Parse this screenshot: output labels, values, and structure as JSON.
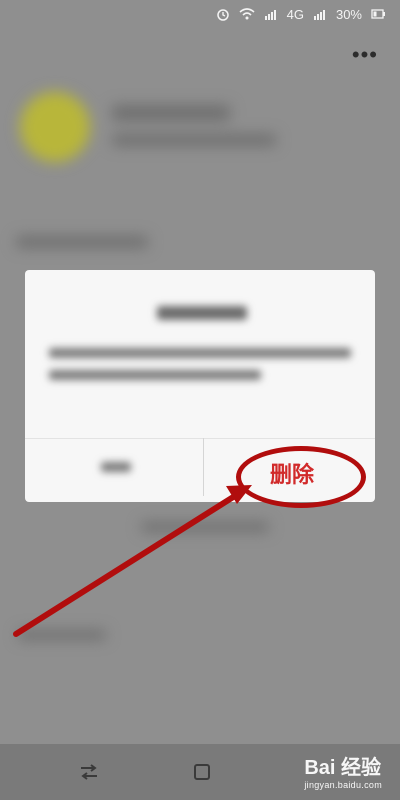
{
  "status_bar": {
    "signal_type": "4G",
    "battery_percent": "30%",
    "icons": [
      "alarm-icon",
      "wifi-icon",
      "signal-icon",
      "signal-icon",
      "battery-icon"
    ]
  },
  "top_bar": {
    "more_symbol": "•••"
  },
  "dialog": {
    "delete_label": "删除"
  },
  "navigation": {
    "icons": [
      "swap-icon",
      "square-icon"
    ]
  },
  "watermark": {
    "title": "Bai 经验",
    "url": "jingyan.baidu.com"
  },
  "colors": {
    "highlight": "#b10d0d",
    "delete_text": "#d12a2a",
    "dialog_bg": "#f7f7f7"
  }
}
